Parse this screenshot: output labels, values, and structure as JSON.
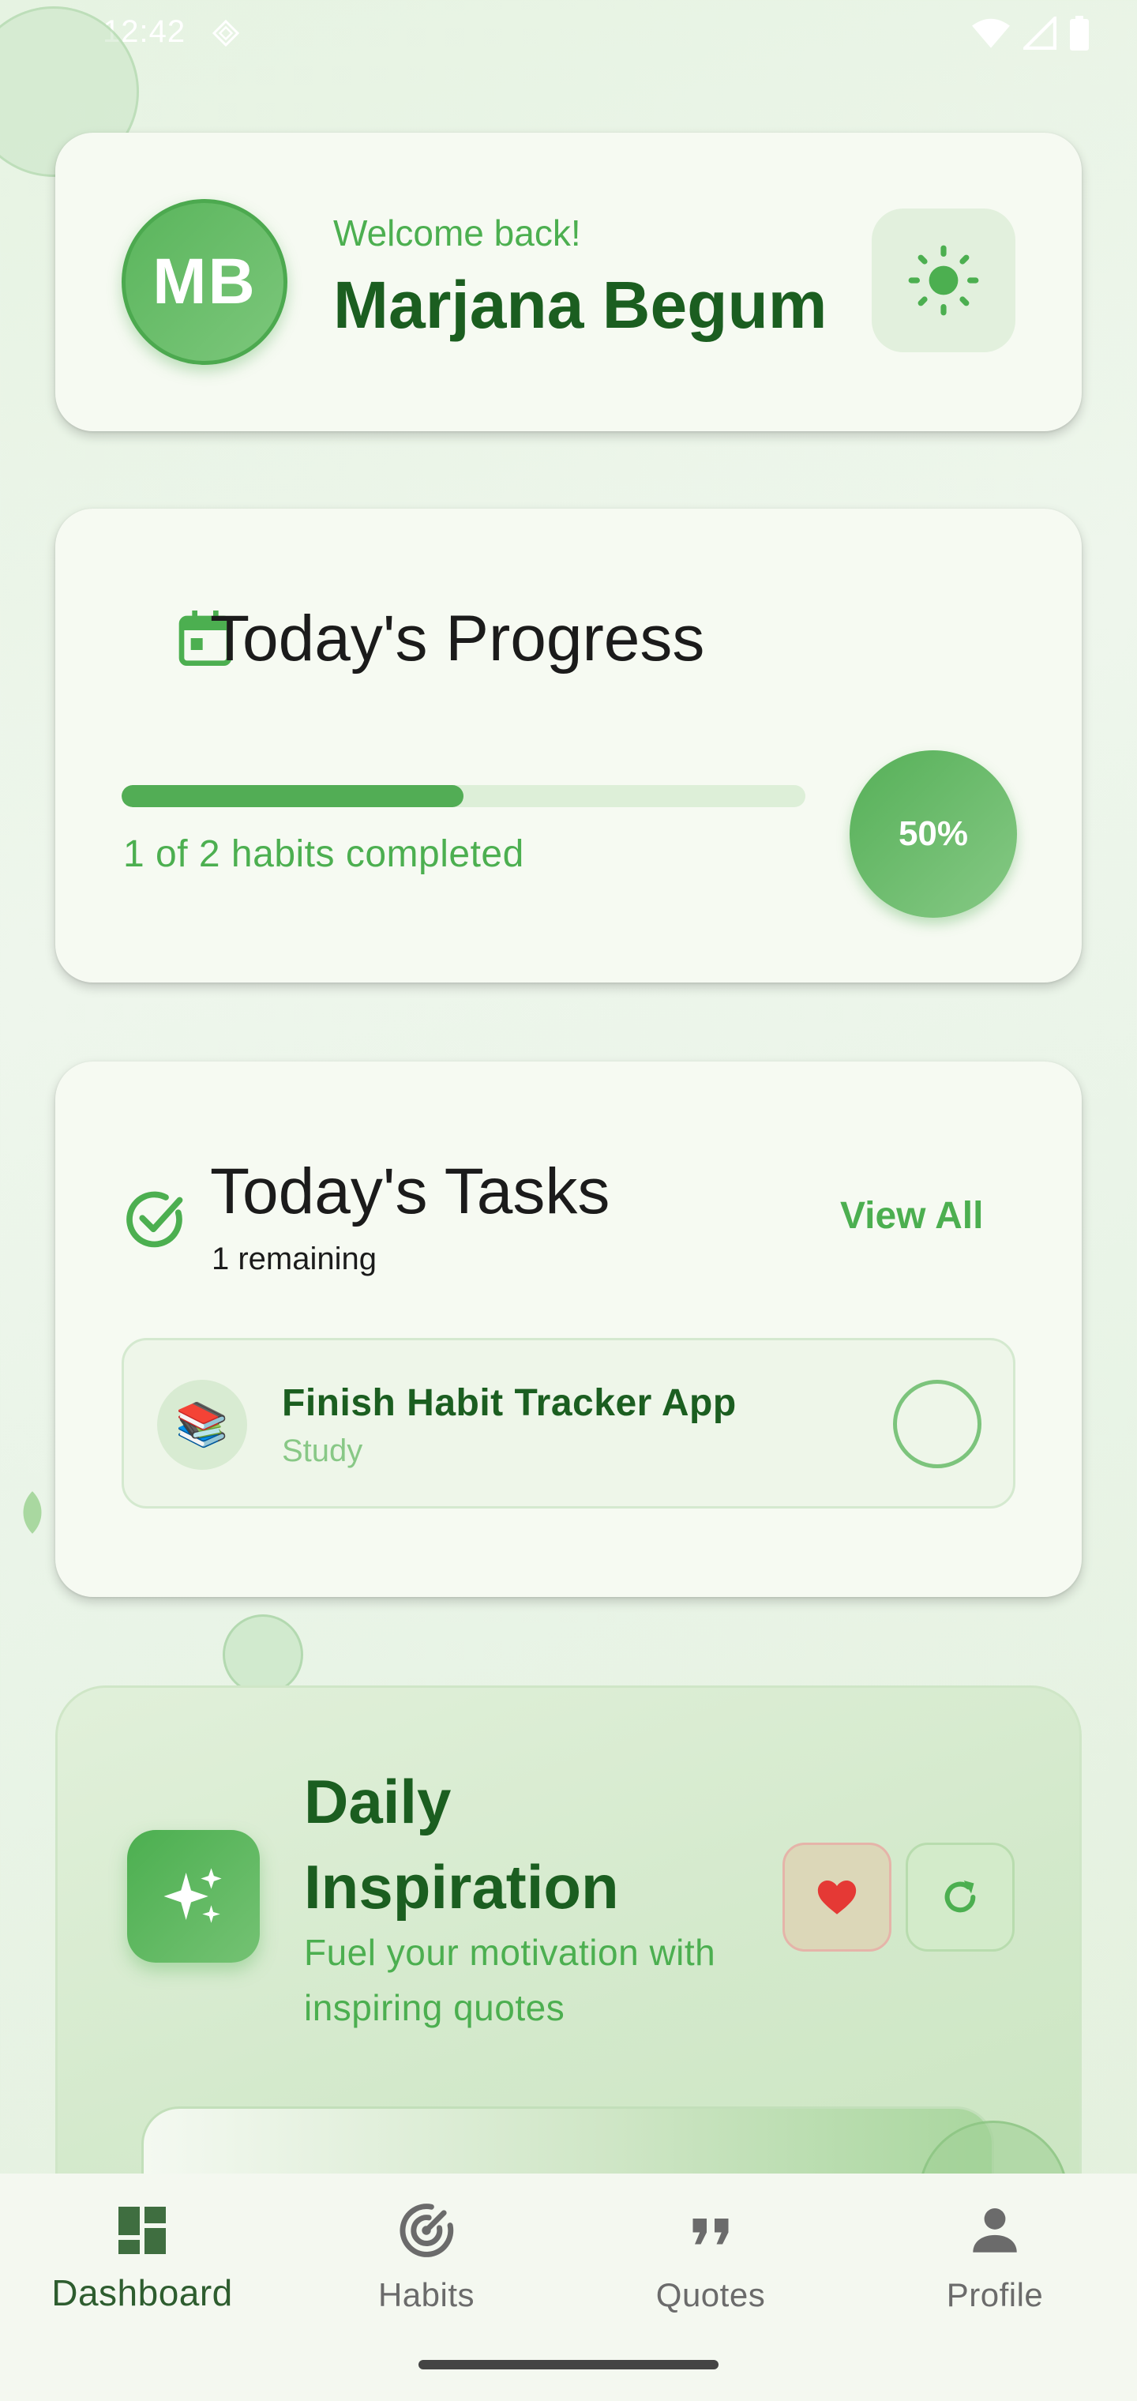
{
  "status_bar": {
    "time": "12:42"
  },
  "header": {
    "avatar_initials": "MB",
    "welcome": "Welcome back!",
    "user_name": "Marjana Begum",
    "theme_icon": "sun-icon"
  },
  "progress": {
    "title": "Today's Progress",
    "completed_fraction": 0.5,
    "summary": "1 of 2 habits completed",
    "percent_label": "50%"
  },
  "tasks": {
    "title": "Today's Tasks",
    "remaining": "1 remaining",
    "view_all": "View All",
    "items": [
      {
        "emoji": "📚",
        "title": "Finish Habit Tracker App",
        "category": "Study",
        "done": false
      }
    ]
  },
  "inspiration": {
    "title": "Daily Inspiration",
    "subtitle": "Fuel your motivation with inspiring quotes"
  },
  "nav": {
    "items": [
      {
        "label": "Dashboard",
        "icon": "dashboard-icon",
        "active": true
      },
      {
        "label": "Habits",
        "icon": "target-icon",
        "active": false
      },
      {
        "label": "Quotes",
        "icon": "quote-icon",
        "active": false
      },
      {
        "label": "Profile",
        "icon": "person-icon",
        "active": false
      }
    ]
  },
  "colors": {
    "accent": "#4caf50",
    "dark_green": "#1b5e20",
    "heart": "#e53935"
  }
}
